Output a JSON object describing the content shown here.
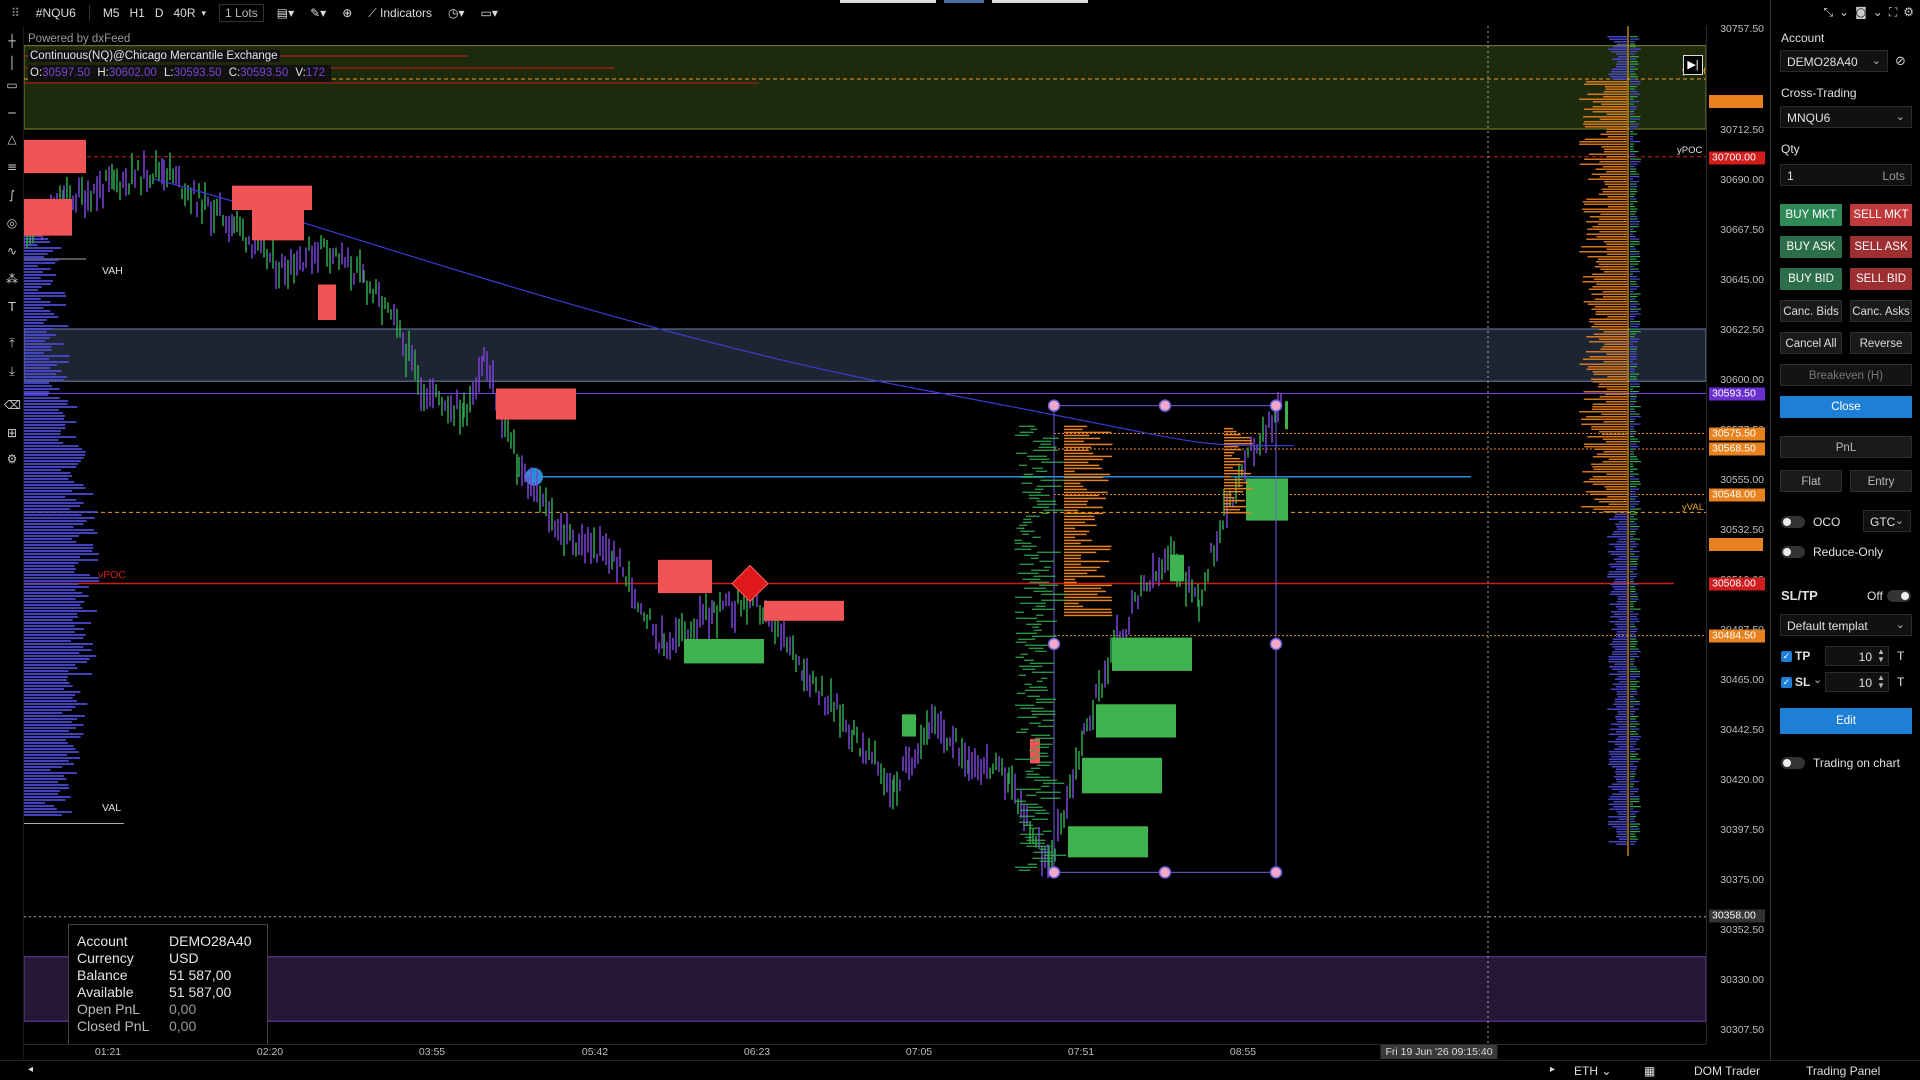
{
  "toolbar": {
    "symbol": "#NQU6",
    "timeframes": [
      "M5",
      "H1",
      "D",
      "40R"
    ],
    "lots": "1 Lots",
    "indicators_label": "Indicators"
  },
  "chart_info": {
    "powered_by": "Powered by dxFeed",
    "title": "Continuous(NQ)@Chicago Mercantile Exchange",
    "ohlc": [
      {
        "k": "O:",
        "v": "30597.50"
      },
      {
        "k": "H:",
        "v": "30602.00"
      },
      {
        "k": "L:",
        "v": "30593.50"
      },
      {
        "k": "C:",
        "v": "30593.50"
      },
      {
        "k": "V:",
        "v": "172"
      }
    ]
  },
  "chart_labels": {
    "vah_left": "VAH",
    "val_left": "VAL",
    "vpoc_left": "vPOC",
    "yvah": "yVAH",
    "ypoc": "yPOC",
    "yval": "yVAL"
  },
  "price_axis": {
    "labels": [
      "30757.50",
      "30712.50",
      "30690.00",
      "30667.50",
      "30645.00",
      "30622.50",
      "30600.00",
      "30577.50",
      "30555.00",
      "30532.50",
      "30510.00",
      "30487.50",
      "30465.00",
      "30442.50",
      "30420.00",
      "30397.50",
      "30375.00",
      "30352.50",
      "30330.00",
      "30307.50"
    ],
    "tags": [
      {
        "label": "30700.00",
        "color": "#d01c1c"
      },
      {
        "label": "30593.50",
        "color": "#6b2fd0"
      },
      {
        "label": "30575.50",
        "color": "#e8821e"
      },
      {
        "label": "30568.50",
        "color": "#e8821e"
      },
      {
        "label": "30548.00",
        "color": "#e8821e"
      },
      {
        "label": "30508.00",
        "color": "#d01c1c"
      },
      {
        "label": "30484.50",
        "color": "#e8821e"
      },
      {
        "label": "30358.00",
        "color": "#333333"
      }
    ]
  },
  "time_axis": {
    "labels": [
      "01:21",
      "02:20",
      "03:55",
      "05:42",
      "06:23",
      "07:05",
      "07:51",
      "08:55"
    ],
    "cursor": "Fri 19 Jun '26 09:15:40"
  },
  "account_box": {
    "rows": [
      {
        "k": "Account",
        "v": "DEMO28A40"
      },
      {
        "k": "Currency",
        "v": "USD"
      },
      {
        "k": "Balance",
        "v": "51 587,00"
      },
      {
        "k": "Available",
        "v": "51 587,00"
      },
      {
        "k": "Open PnL",
        "v": "0,00"
      },
      {
        "k": "Closed PnL",
        "v": "0,00"
      }
    ]
  },
  "panel": {
    "account_label": "Account",
    "account_value": "DEMO28A40",
    "cross_label": "Cross-Trading",
    "cross_value": "MNQU6",
    "qty_label": "Qty",
    "qty_value": "1",
    "qty_unit": "Lots",
    "buy_mkt": "BUY MKT",
    "sell_mkt": "SELL MKT",
    "buy_ask": "BUY ASK",
    "sell_ask": "SELL ASK",
    "buy_bid": "BUY BID",
    "sell_bid": "SELL BID",
    "canc_bids": "Canc. Bids",
    "canc_asks": "Canc. Asks",
    "cancel_all": "Cancel All",
    "reverse": "Reverse",
    "breakeven": "Breakeven (H)",
    "close": "Close",
    "pnl": "PnL",
    "flat": "Flat",
    "entry": "Entry",
    "oco": "OCO",
    "gtc": "GTC",
    "reduce_only": "Reduce-Only",
    "sltp": "SL/TP",
    "sltp_state": "Off",
    "template": "Default templat",
    "tp": "TP",
    "tp_value": "10",
    "tp_unit": "T",
    "sl": "SL",
    "sl_value": "10",
    "sl_unit": "T",
    "edit": "Edit",
    "trading_on_chart": "Trading on chart"
  },
  "status_bar": {
    "session": "ETH",
    "dom_trader": "DOM Trader",
    "trading_panel": "Trading Panel"
  },
  "colors": {
    "candle": "#7b43d6",
    "candle_green": "#2fa84f",
    "vwap": "#3a3ad0",
    "supply": "#f05454",
    "demand": "#3fb34f"
  }
}
